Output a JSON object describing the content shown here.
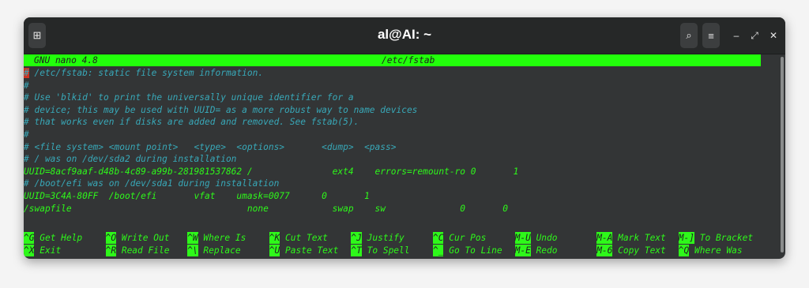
{
  "window": {
    "title": "al@AI: ~",
    "new_tab_glyph": "⊞",
    "search_glyph": "⌕",
    "menu_glyph": "≡",
    "minimize_glyph": "–",
    "maximize_glyph": "⤢",
    "close_glyph": "✕"
  },
  "nano": {
    "version": "GNU nano 4.8",
    "filename": "/etc/fstab",
    "cursor_char": "#",
    "first_line_rest": " /etc/fstab: static file system information.",
    "lines": [
      {
        "text": "#",
        "type": "comment"
      },
      {
        "text": "# Use 'blkid' to print the universally unique identifier for a",
        "type": "comment"
      },
      {
        "text": "# device; this may be used with UUID= as a more robust way to name devices",
        "type": "comment"
      },
      {
        "text": "# that works even if disks are added and removed. See fstab(5).",
        "type": "comment"
      },
      {
        "text": "#",
        "type": "comment"
      },
      {
        "text": "# <file system> <mount point>   <type>  <options>       <dump>  <pass>",
        "type": "comment"
      },
      {
        "text": "# / was on /dev/sda2 during installation",
        "type": "comment"
      },
      {
        "text": "UUID=8acf9aaf-d48b-4c89-a99b-281981537862 /               ext4    errors=remount-ro 0       1",
        "type": "normal"
      },
      {
        "text": "# /boot/efi was on /dev/sda1 during installation",
        "type": "comment"
      },
      {
        "text": "UUID=3C4A-80FF  /boot/efi       vfat    umask=0077      0       1",
        "type": "normal"
      },
      {
        "text": "/swapfile                                 none            swap    sw              0       0",
        "type": "normal"
      }
    ],
    "shortcuts_row1": [
      {
        "key": "^G",
        "label": "Get Help"
      },
      {
        "key": "^O",
        "label": "Write Out"
      },
      {
        "key": "^W",
        "label": "Where Is"
      },
      {
        "key": "^K",
        "label": "Cut Text"
      },
      {
        "key": "^J",
        "label": "Justify"
      },
      {
        "key": "^C",
        "label": "Cur Pos"
      },
      {
        "key": "M-U",
        "label": "Undo"
      },
      {
        "key": "M-A",
        "label": "Mark Text"
      },
      {
        "key": "M-]",
        "label": "To Bracket"
      }
    ],
    "shortcuts_row2": [
      {
        "key": "^X",
        "label": "Exit"
      },
      {
        "key": "^R",
        "label": "Read File"
      },
      {
        "key": "^\\",
        "label": "Replace"
      },
      {
        "key": "^U",
        "label": "Paste Text"
      },
      {
        "key": "^T",
        "label": "To Spell"
      },
      {
        "key": "^_",
        "label": "Go To Line"
      },
      {
        "key": "M-E",
        "label": "Redo"
      },
      {
        "key": "M-6",
        "label": "Copy Text"
      },
      {
        "key": "^Q",
        "label": "Where Was"
      }
    ]
  },
  "colors": {
    "terminal_bg": "#333536",
    "nano_green": "#2ef81a",
    "comment_cyan": "#38a8b8",
    "cursor_red": "#cc3322"
  }
}
